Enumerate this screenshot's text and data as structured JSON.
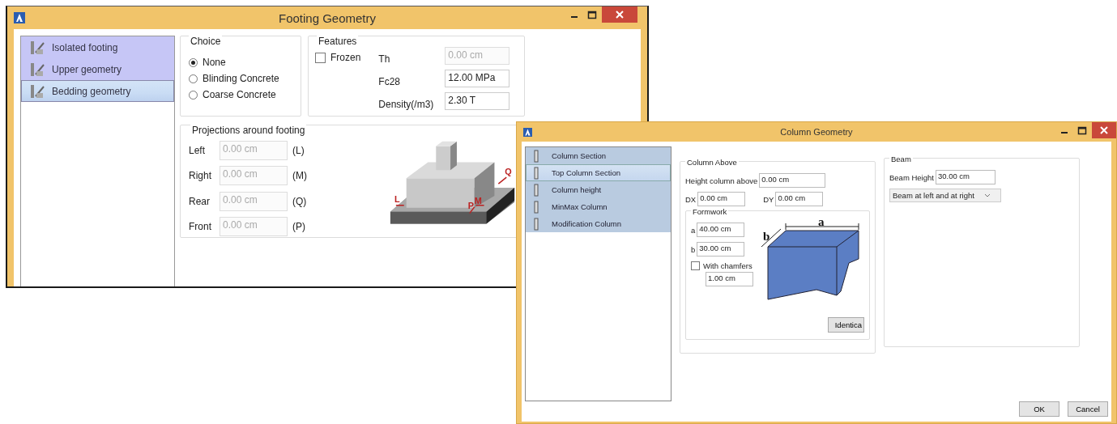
{
  "footing_window": {
    "title": "Footing Geometry",
    "sidebar": [
      {
        "label": "Isolated footing",
        "selected": false
      },
      {
        "label": "Upper geometry",
        "selected": false
      },
      {
        "label": "Bedding geometry",
        "selected": true
      }
    ],
    "choice": {
      "title": "Choice",
      "options": [
        {
          "label": "None",
          "selected": true
        },
        {
          "label": "Blinding Concrete",
          "selected": false
        },
        {
          "label": "Coarse Concrete",
          "selected": false
        }
      ]
    },
    "features": {
      "title": "Features",
      "frozen": {
        "label": "Frozen",
        "checked": false
      },
      "fields": [
        {
          "label": "Th",
          "value": "0.00 cm",
          "disabled": true
        },
        {
          "label": "Fc28",
          "value": "12.00 MPa",
          "disabled": false
        },
        {
          "label": "Density(/m3)",
          "value": "2.30 T",
          "disabled": false
        }
      ]
    },
    "projections": {
      "title": "Projections around footing",
      "rows": [
        {
          "label": "Left",
          "value": "0.00 cm",
          "code": "(L)",
          "disabled": true
        },
        {
          "label": "Right",
          "value": "0.00 cm",
          "code": "(M)",
          "disabled": true
        },
        {
          "label": "Rear",
          "value": "0.00 cm",
          "code": "(Q)",
          "disabled": true
        },
        {
          "label": "Front",
          "value": "0.00 cm",
          "code": "(P)",
          "disabled": true
        }
      ],
      "diagram_labels": [
        "L",
        "P",
        "M",
        "Q"
      ]
    }
  },
  "column_window": {
    "title": "Column Geometry",
    "sidebar": [
      {
        "label": "Column Section",
        "selected": false
      },
      {
        "label": "Top Column Section",
        "selected": true
      },
      {
        "label": "Column height",
        "selected": false
      },
      {
        "label": "MinMax Column",
        "selected": false
      },
      {
        "label": "Modification Column",
        "selected": false
      }
    ],
    "column_above": {
      "title": "Column Above",
      "height_label": "Height column above",
      "height_value": "0.00 cm",
      "dx_label": "DX",
      "dx_value": "0.00 cm",
      "dy_label": "DY",
      "dy_value": "0.00 cm",
      "formwork": {
        "title": "Formwork",
        "a_label": "a",
        "a_value": "40.00 cm",
        "b_label": "b",
        "b_value": "30.00 cm",
        "chamfers": {
          "label": "With chamfers",
          "checked": false
        },
        "chamfer_value": "1.00 cm",
        "dimension_labels": [
          "a",
          "b"
        ],
        "button": "Identica"
      }
    },
    "beam": {
      "title": "Beam",
      "height_label": "Beam Height",
      "height_value": "30.00 cm",
      "dropdown": "Beam at left and at right"
    },
    "buttons": [
      "OK",
      "Cancel"
    ]
  }
}
